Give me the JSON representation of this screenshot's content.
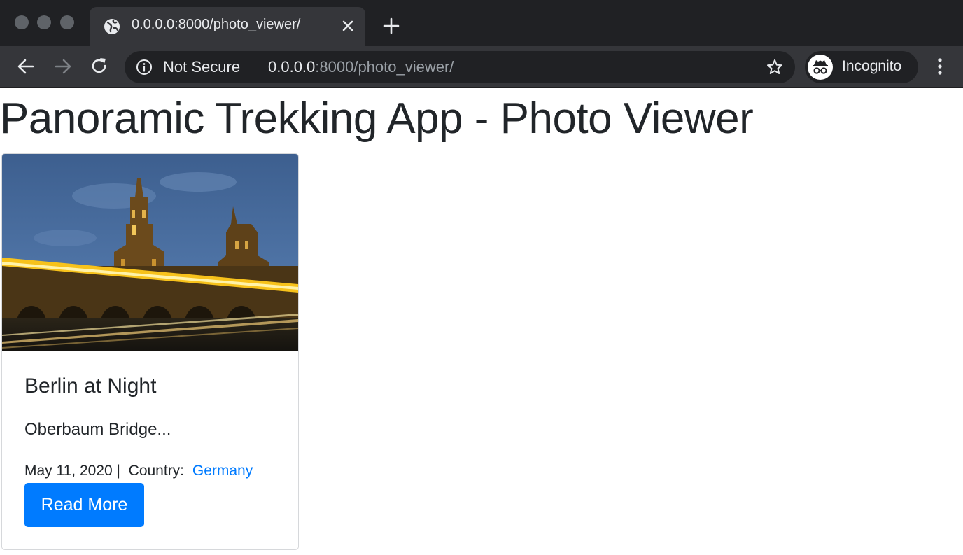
{
  "browser": {
    "tab": {
      "title": "0.0.0.0:8000/photo_viewer/"
    },
    "omnibox": {
      "security_label": "Not Secure",
      "url_host": "0.0.0.0",
      "url_path": ":8000/photo_viewer/"
    },
    "profile": {
      "label": "Incognito"
    },
    "icons": [
      "globe-icon",
      "close-icon",
      "plus-icon",
      "back-arrow-icon",
      "forward-arrow-icon",
      "reload-icon",
      "info-icon",
      "star-icon",
      "incognito-icon",
      "kebab-menu-icon"
    ]
  },
  "page": {
    "title": "Panoramic Trekking App - Photo Viewer"
  },
  "cards": [
    {
      "title": "Berlin at Night",
      "text": "Oberbaum Bridge...",
      "date": "May 11, 2020 |",
      "country_label": "Country:",
      "country": "Germany",
      "button_label": "Read More"
    }
  ],
  "colors": {
    "primary": "#007bff",
    "chrome_dark": "#202124",
    "chrome_toolbar": "#35363a"
  }
}
